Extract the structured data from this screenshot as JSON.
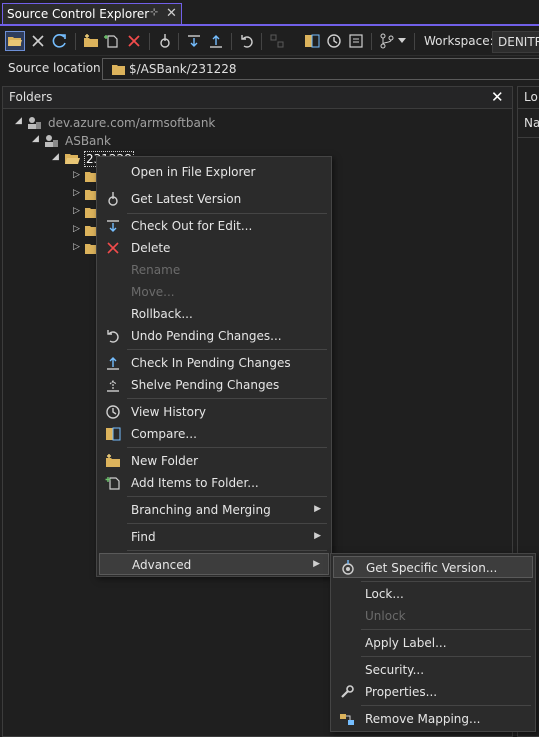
{
  "tab": {
    "title": "Source Control Explorer",
    "pin": "⊹",
    "close": "✕"
  },
  "toolbar": {
    "workspace_label": "Workspace:",
    "workspace_value": "DENITRO"
  },
  "source_location": {
    "label": "Source location:",
    "value": "$/ASBank/231228"
  },
  "folders_panel": {
    "title": "Folders",
    "tree": {
      "server": "dev.azure.com/armsoftbank",
      "project": "ASBank",
      "selected_folder": "231228"
    }
  },
  "right_panel": {
    "header": "Lo",
    "column": "Na"
  },
  "context_menu": {
    "items": [
      {
        "label": "Open in File Explorer"
      },
      {
        "label": "Get Latest Version"
      },
      {
        "label": "Check Out for Edit..."
      },
      {
        "label": "Delete"
      },
      {
        "label": "Rename"
      },
      {
        "label": "Move..."
      },
      {
        "label": "Rollback..."
      },
      {
        "label": "Undo Pending Changes..."
      },
      {
        "label": "Check In Pending Changes"
      },
      {
        "label": "Shelve Pending Changes"
      },
      {
        "label": "View History"
      },
      {
        "label": "Compare..."
      },
      {
        "label": "New Folder"
      },
      {
        "label": "Add Items to Folder..."
      },
      {
        "label": "Branching and Merging"
      },
      {
        "label": "Find"
      },
      {
        "label": "Advanced"
      }
    ]
  },
  "advanced_submenu": {
    "items": [
      {
        "label": "Get Specific Version..."
      },
      {
        "label": "Lock..."
      },
      {
        "label": "Unlock"
      },
      {
        "label": "Apply Label..."
      },
      {
        "label": "Security..."
      },
      {
        "label": "Properties..."
      },
      {
        "label": "Remove Mapping..."
      }
    ]
  },
  "colors": {
    "accent": "#7160e8",
    "folder": "#dcb35c",
    "icon_blue": "#75beff",
    "delete_red": "#f14c4c"
  }
}
